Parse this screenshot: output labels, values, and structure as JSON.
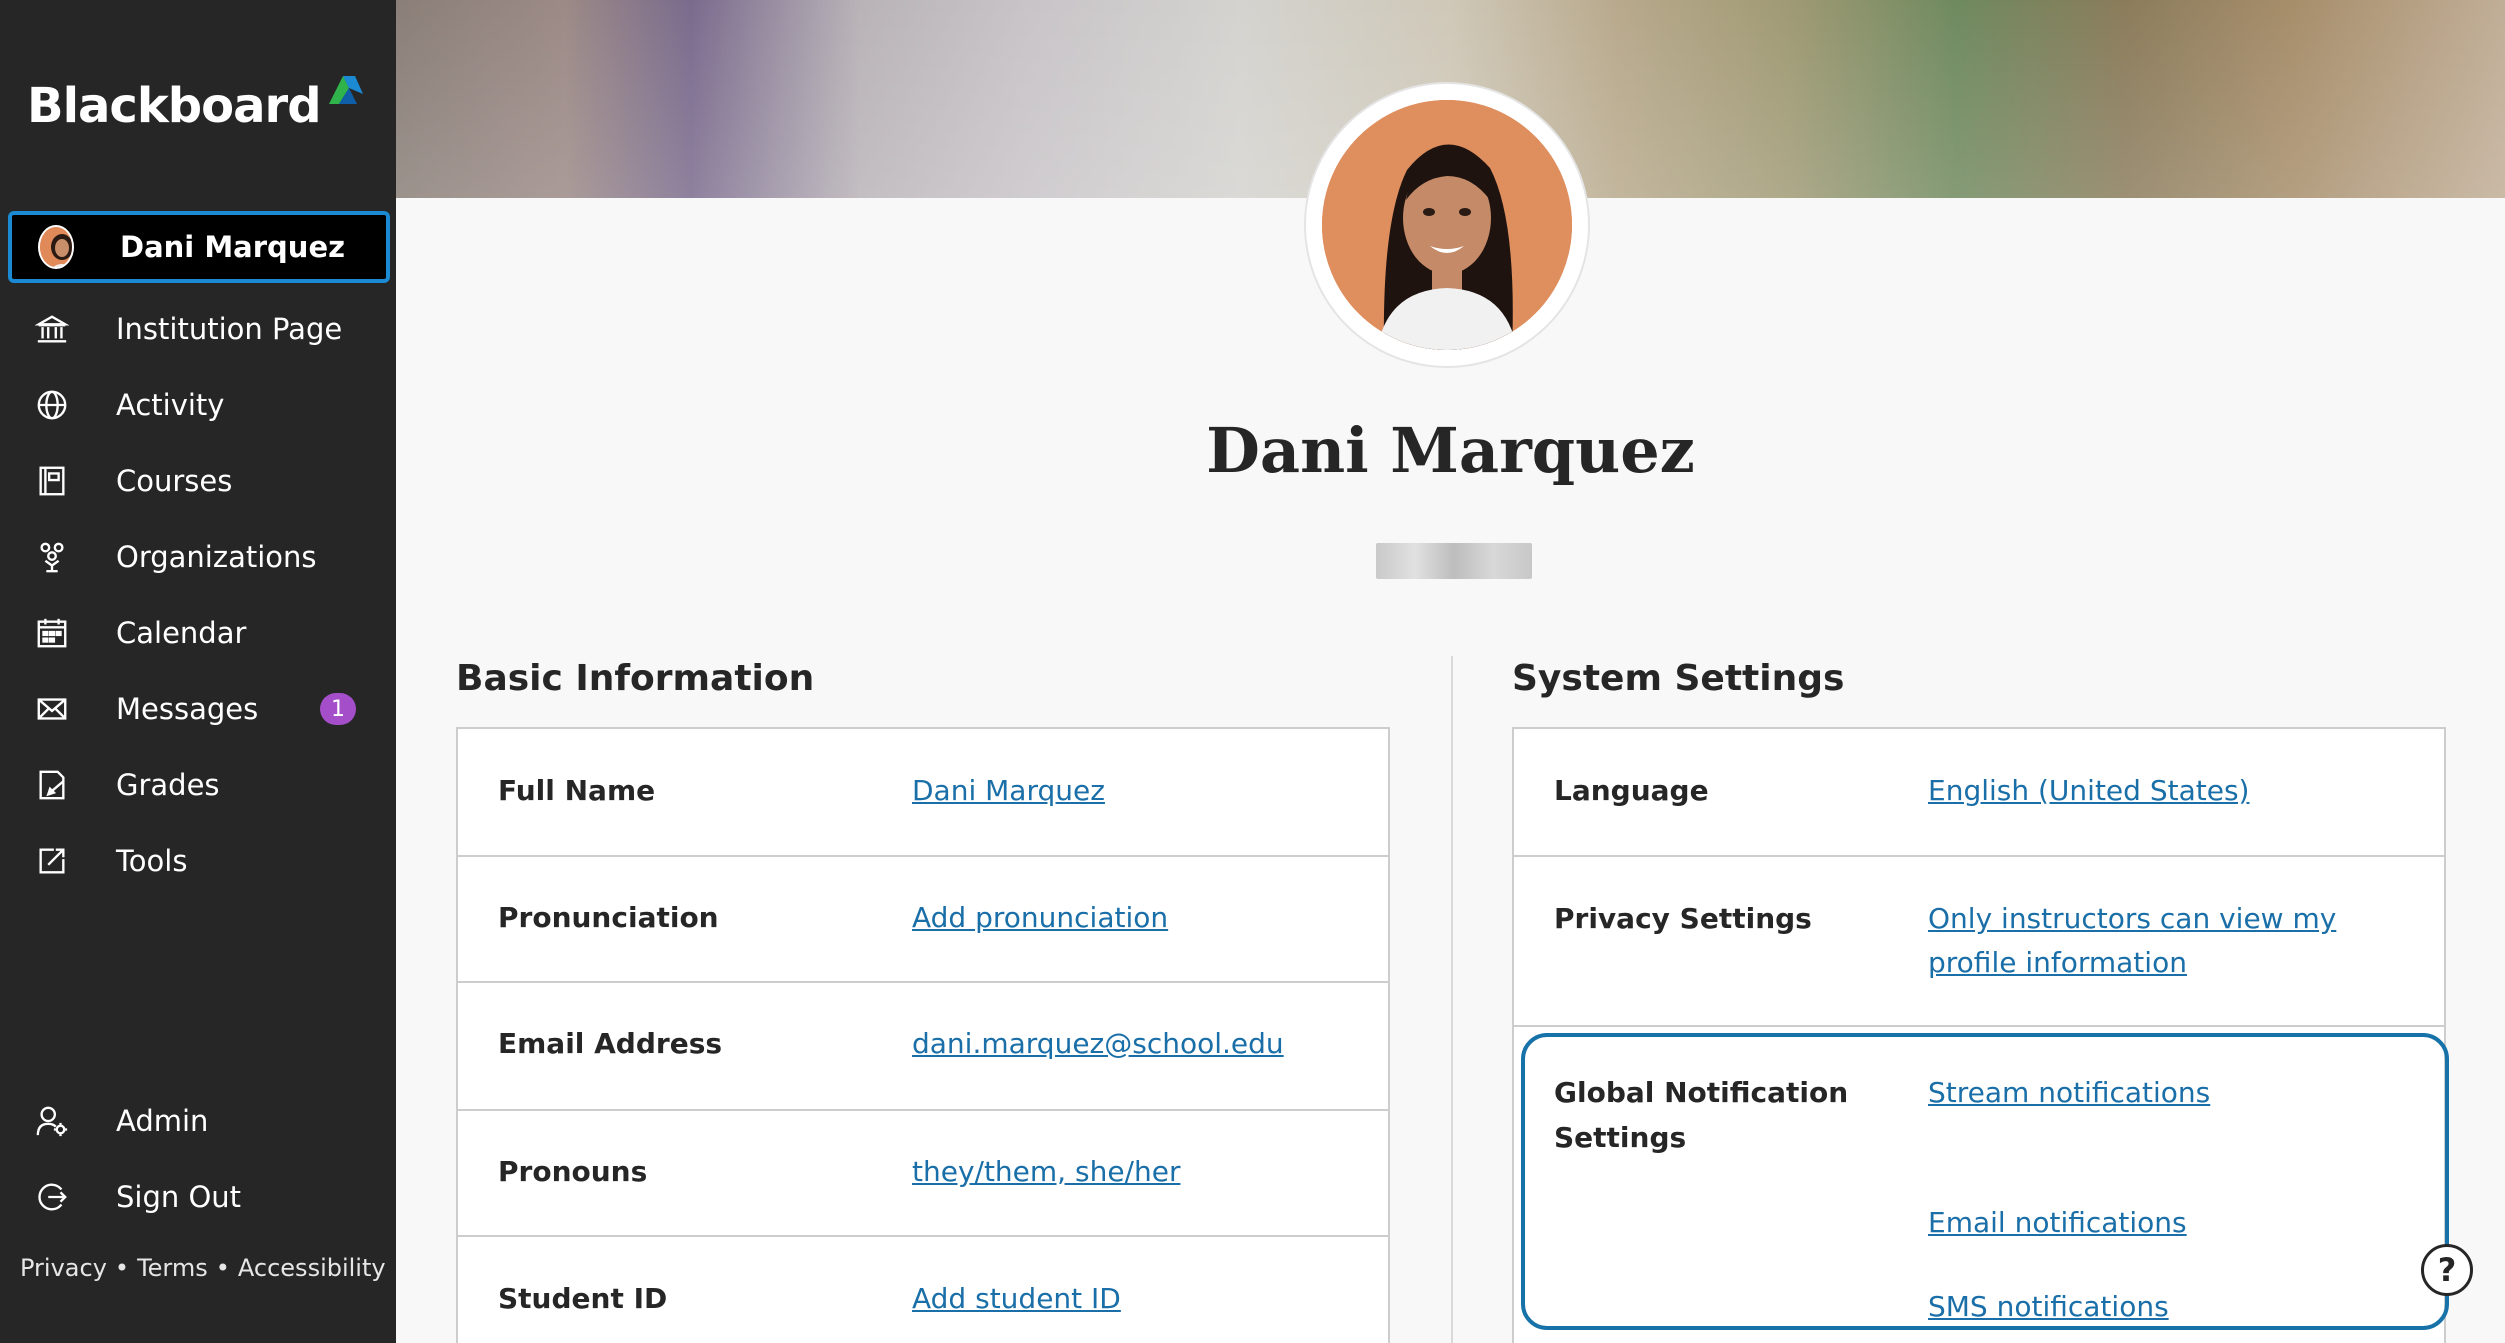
{
  "brand": {
    "name": "Blackboard",
    "accent_colors": [
      "#1b8ad3",
      "#2fb34a",
      "#0e5fa8"
    ]
  },
  "sidebar": {
    "items": [
      {
        "label": "Dani Marquez",
        "icon": "user-avatar",
        "active": true
      },
      {
        "label": "Institution Page",
        "icon": "institution-icon"
      },
      {
        "label": "Activity",
        "icon": "globe-icon"
      },
      {
        "label": "Courses",
        "icon": "courses-icon"
      },
      {
        "label": "Organizations",
        "icon": "organizations-icon"
      },
      {
        "label": "Calendar",
        "icon": "calendar-icon"
      },
      {
        "label": "Messages",
        "icon": "envelope-icon",
        "badge": "1"
      },
      {
        "label": "Grades",
        "icon": "grades-icon"
      },
      {
        "label": "Tools",
        "icon": "tools-icon"
      }
    ],
    "bottom_items": [
      {
        "label": "Admin",
        "icon": "admin-icon"
      },
      {
        "label": "Sign Out",
        "icon": "sign-out-icon"
      }
    ],
    "footer": {
      "privacy": "Privacy",
      "terms": "Terms",
      "accessibility": "Accessibility",
      "separator": "•"
    }
  },
  "profile": {
    "name": "Dani Marquez"
  },
  "basic_info": {
    "title": "Basic Information",
    "rows": [
      {
        "key": "Full Name",
        "value": "Dani Marquez"
      },
      {
        "key": "Pronunciation",
        "value": "Add pronunciation"
      },
      {
        "key": "Email Address",
        "value": "dani.marquez@school.edu"
      },
      {
        "key": "Pronouns",
        "value": "they/them, she/her"
      },
      {
        "key": "Student ID",
        "value": "Add student ID"
      }
    ]
  },
  "system_settings": {
    "title": "System Settings",
    "language": {
      "key": "Language",
      "value": "English (United States)"
    },
    "privacy": {
      "key": "Privacy Settings",
      "value_line1": "Only instructors can view my",
      "value_line2": "profile information"
    },
    "notifications": {
      "key_line1": "Global Notification",
      "key_line2": "Settings",
      "stream": "Stream notifications",
      "email": "Email notifications",
      "sms": "SMS notifications"
    }
  },
  "help": {
    "icon": "help-icon",
    "glyph": "?"
  }
}
